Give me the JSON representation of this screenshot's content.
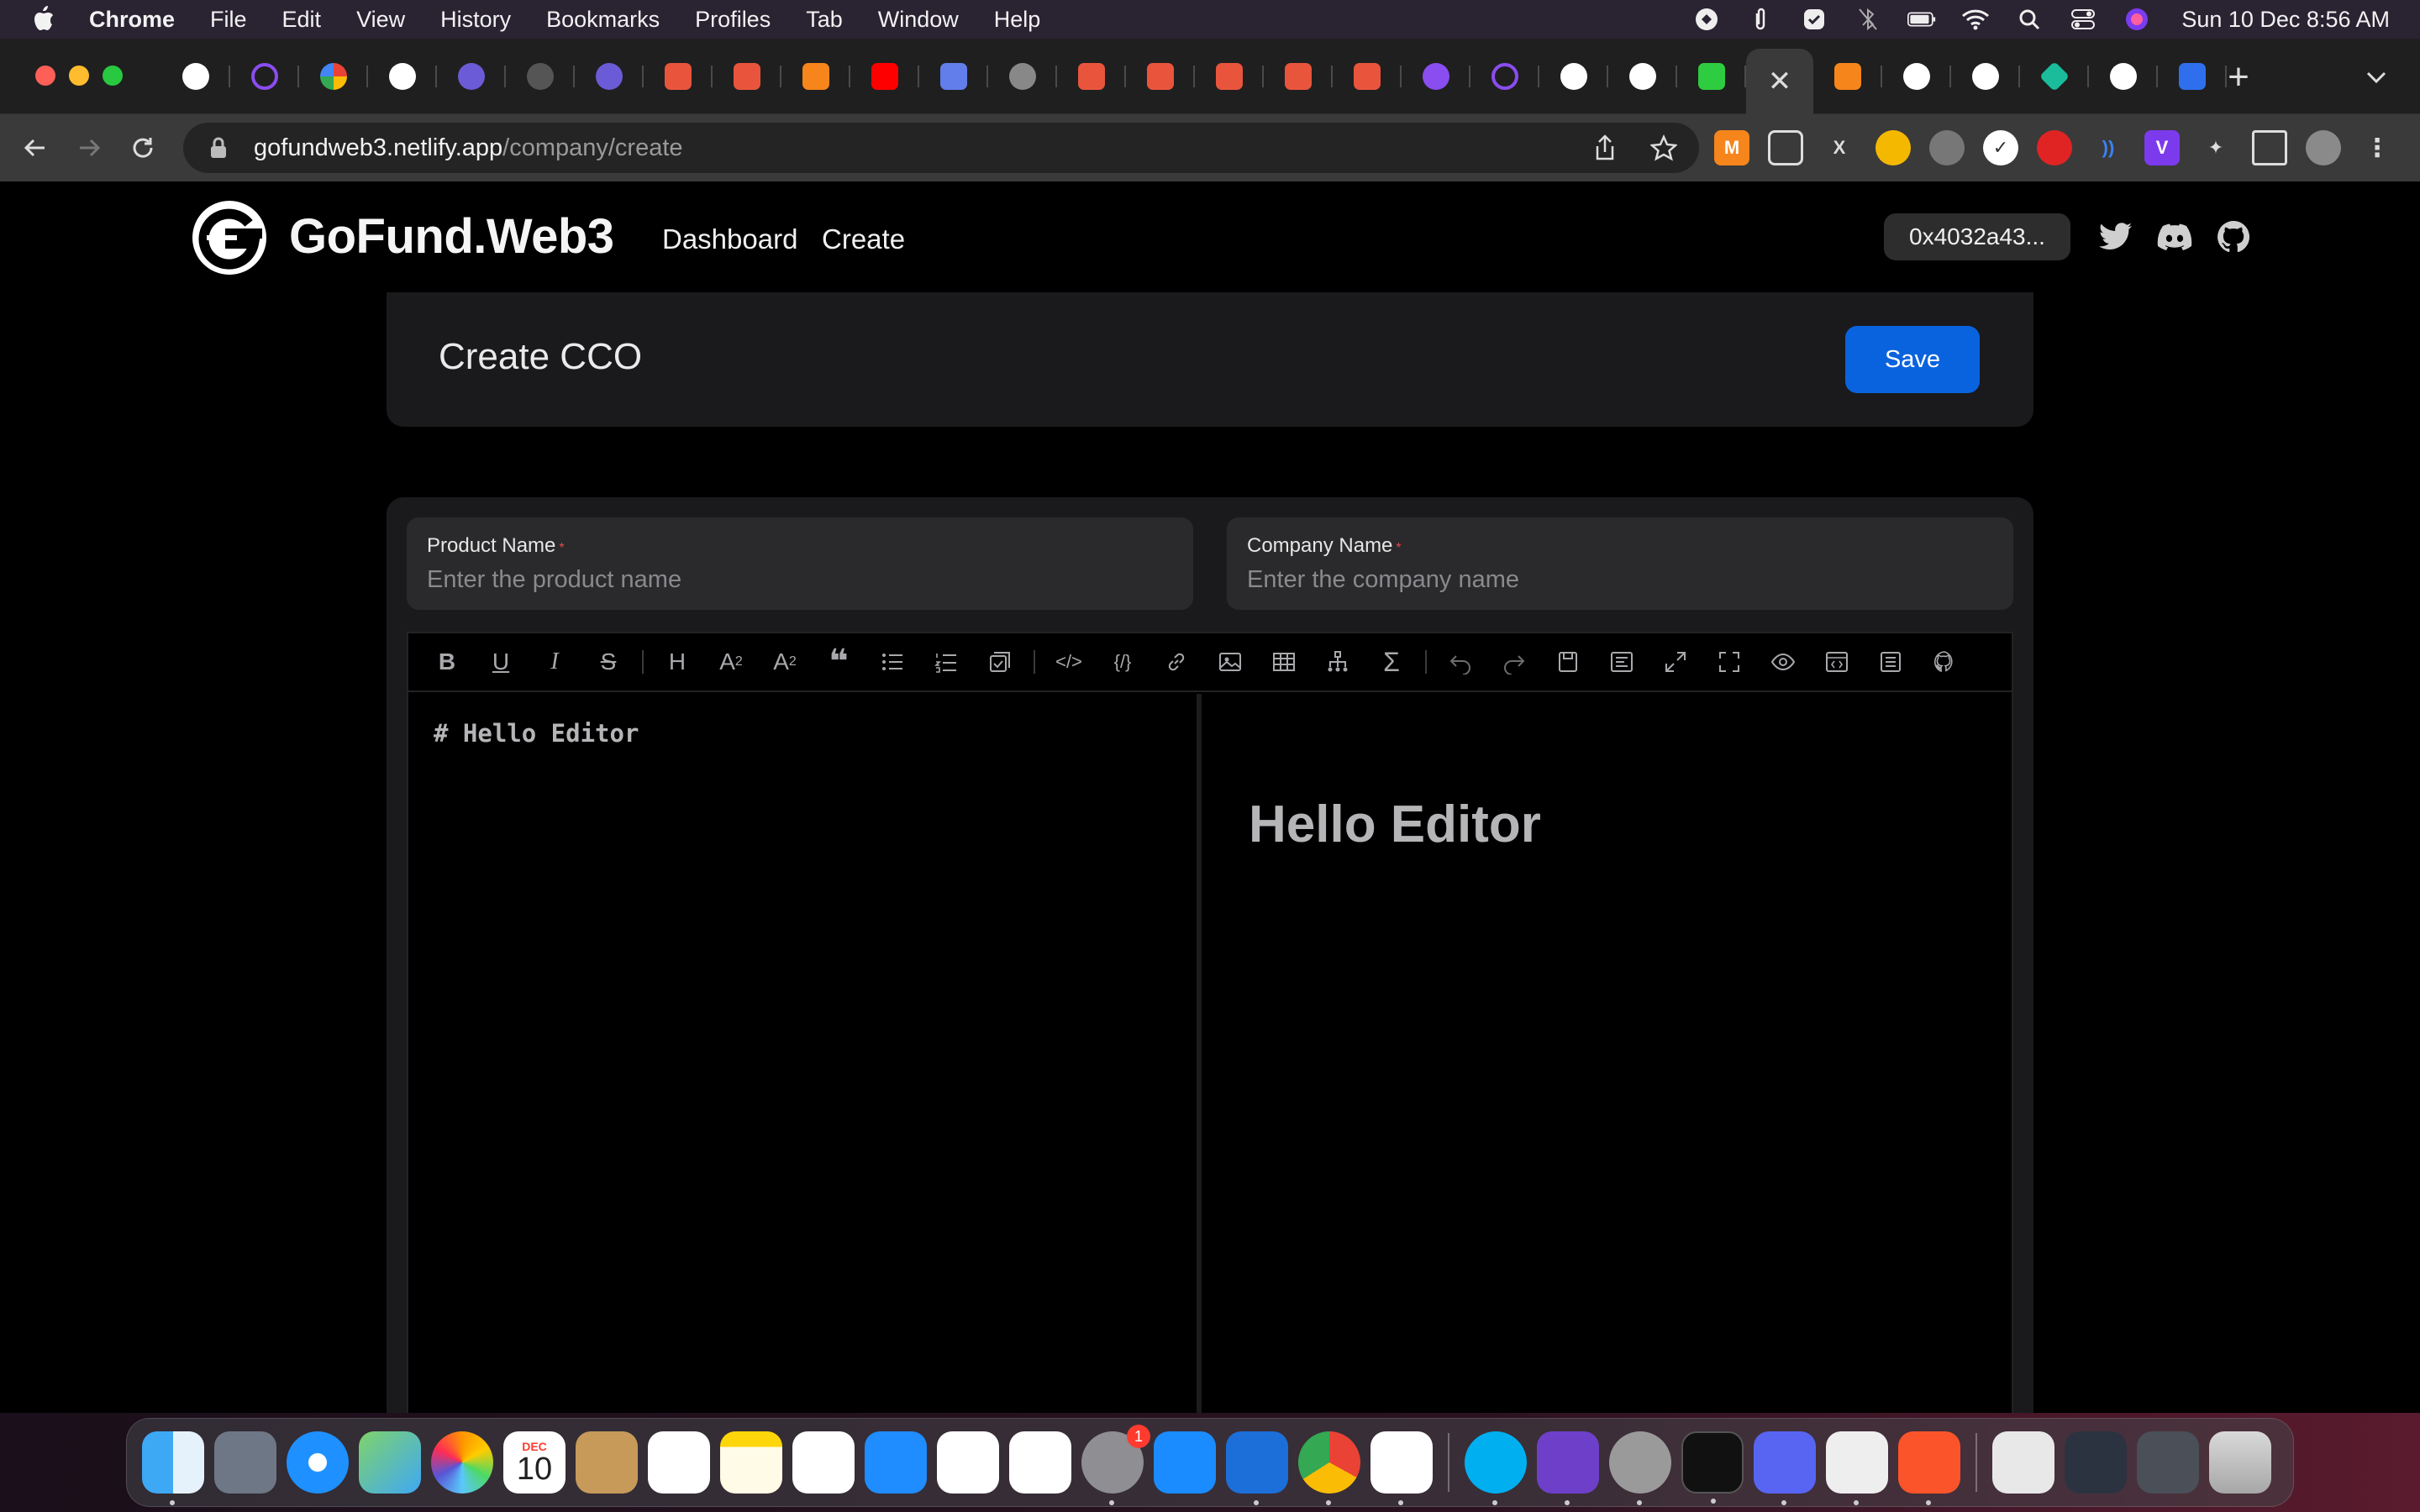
{
  "menubar": {
    "app_name": "Chrome",
    "menus": [
      "File",
      "Edit",
      "View",
      "History",
      "Bookmarks",
      "Profiles",
      "Tab",
      "Window",
      "Help"
    ],
    "clock": "Sun 10 Dec  8:56 AM"
  },
  "browser": {
    "url_host": "gofundweb3.netlify.app",
    "url_path": "/company/create"
  },
  "site": {
    "brand": "GoFund.Web3",
    "nav": {
      "dashboard": "Dashboard",
      "create": "Create"
    },
    "wallet": "0x4032a43..."
  },
  "form": {
    "title": "Create CCO",
    "save_label": "Save",
    "product": {
      "label": "Product Name",
      "required_mark": "*",
      "placeholder": "Enter the product name"
    },
    "company": {
      "label": "Company Name",
      "required_mark": "*",
      "placeholder": "Enter the company name"
    }
  },
  "editor": {
    "source_text": "# Hello Editor",
    "preview_heading": "Hello Editor"
  },
  "dock": {
    "calendar_month": "DEC",
    "calendar_day": "10",
    "settings_badge": "1"
  },
  "colors": {
    "accent": "#0a63de",
    "required": "#e5484d",
    "page_bg": "#000000",
    "card_bg": "#1a1a1c"
  }
}
